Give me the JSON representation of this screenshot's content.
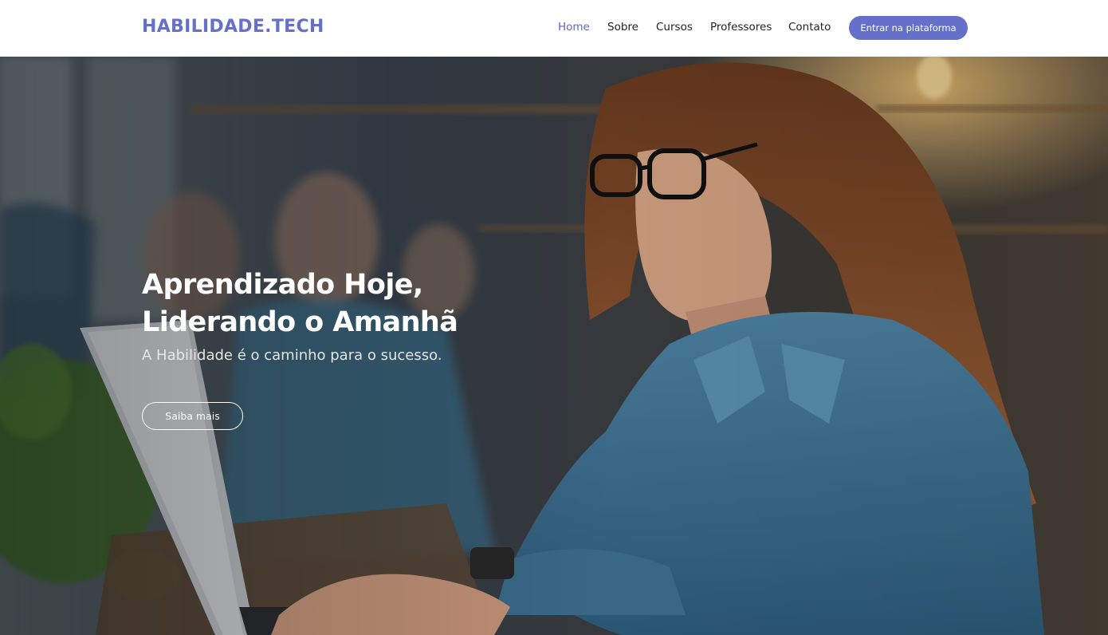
{
  "brand": {
    "name": "HABILIDADE.TECH",
    "color": "#6470c9"
  },
  "nav": {
    "items": [
      {
        "label": "Home",
        "active": true
      },
      {
        "label": "Sobre",
        "active": false
      },
      {
        "label": "Cursos",
        "active": false
      },
      {
        "label": "Professores",
        "active": false
      },
      {
        "label": "Contato",
        "active": false
      }
    ],
    "cta_label": "Entrar na plataforma"
  },
  "hero": {
    "title_line1": "Aprendizado Hoje,",
    "title_line2": "Liderando o Amanhã",
    "subtitle": "A Habilidade é o caminho para o sucesso.",
    "button_label": "Saiba mais",
    "image": "woman-with-glasses-using-laptop-in-coworking-photo"
  }
}
